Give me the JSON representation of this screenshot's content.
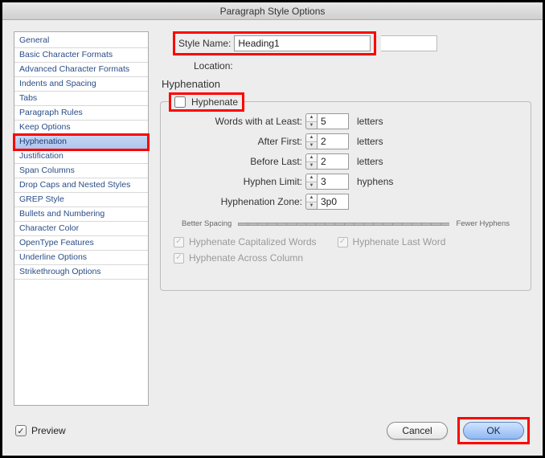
{
  "window": {
    "title": "Paragraph Style Options"
  },
  "styleName": {
    "label": "Style Name:",
    "value": "Heading1"
  },
  "location": {
    "label": "Location:"
  },
  "sectionTitle": "Hyphenation",
  "sidebar": {
    "items": [
      {
        "label": "General"
      },
      {
        "label": "Basic Character Formats"
      },
      {
        "label": "Advanced Character Formats"
      },
      {
        "label": "Indents and Spacing"
      },
      {
        "label": "Tabs"
      },
      {
        "label": "Paragraph Rules"
      },
      {
        "label": "Keep Options"
      },
      {
        "label": "Hyphenation",
        "selected": true
      },
      {
        "label": "Justification"
      },
      {
        "label": "Span Columns"
      },
      {
        "label": "Drop Caps and Nested Styles"
      },
      {
        "label": "GREP Style"
      },
      {
        "label": "Bullets and Numbering"
      },
      {
        "label": "Character Color"
      },
      {
        "label": "OpenType Features"
      },
      {
        "label": "Underline Options"
      },
      {
        "label": "Strikethrough Options"
      }
    ]
  },
  "hyphenate": {
    "label": "Hyphenate",
    "checked": false
  },
  "params": {
    "wordsAtLeast": {
      "label": "Words with at Least:",
      "value": "5",
      "unit": "letters"
    },
    "afterFirst": {
      "label": "After First:",
      "value": "2",
      "unit": "letters"
    },
    "beforeLast": {
      "label": "Before Last:",
      "value": "2",
      "unit": "letters"
    },
    "hyphenLimit": {
      "label": "Hyphen Limit:",
      "value": "3",
      "unit": "hyphens"
    },
    "zone": {
      "label": "Hyphenation Zone:",
      "value": "3p0",
      "unit": ""
    }
  },
  "slider": {
    "leftLabel": "Better Spacing",
    "rightLabel": "Fewer Hyphens"
  },
  "checks": {
    "cap": {
      "label": "Hyphenate Capitalized Words",
      "checked": true
    },
    "last": {
      "label": "Hyphenate Last Word",
      "checked": true
    },
    "across": {
      "label": "Hyphenate Across Column",
      "checked": true
    }
  },
  "footer": {
    "preview": {
      "label": "Preview",
      "checked": true
    },
    "cancel": "Cancel",
    "ok": "OK"
  }
}
